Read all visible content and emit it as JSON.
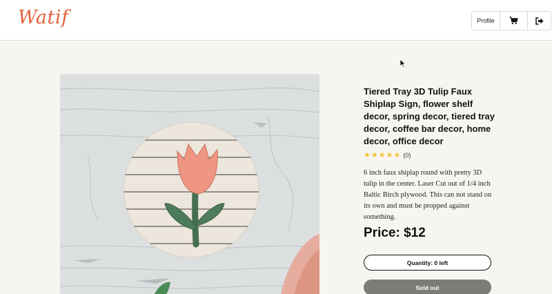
{
  "header": {
    "logo": "Watif",
    "nav": {
      "profile_label": "Profile",
      "cart_icon": "cart-icon",
      "logout_icon": "logout-icon"
    }
  },
  "product": {
    "image_description_icon": "tulip-sign-image",
    "title": "Tiered Tray 3D Tulip Faux Shiplap Sign, flower shelf decor, spring decor, tiered tray decor, coffee bar decor, home decor, office decor",
    "rating": {
      "stars": 5,
      "count_label": "(0)"
    },
    "description": "6 inch faux shiplap round with pretty 3D tulip in the center. Laser Cut out of 1/4 inch Baltic Birch plywood. This can not stand on its own and must be propped against something.",
    "price_label": "Price: $12",
    "quantity_label": "Quantity: 0 left",
    "sold_out_label": "Sold out"
  },
  "colors": {
    "brand": "#e2603a",
    "background": "#f7f5f0",
    "sold_out_bg": "#7e7c79",
    "star": "#f4c430"
  }
}
